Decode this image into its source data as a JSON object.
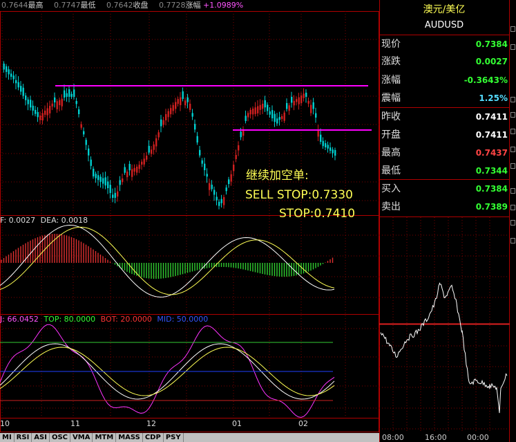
{
  "header": {
    "items": [
      {
        "value": "0.7644",
        "label": "最高"
      },
      {
        "value": "0.7747",
        "label": "最低"
      },
      {
        "value": "0.7642",
        "label": "收盘"
      },
      {
        "value": "0.7728",
        "label": "涨幅"
      }
    ],
    "change": "+1.0989%"
  },
  "macd_header": {
    "dif": "F: 0.0027",
    "dea": "DEA: 0.0018"
  },
  "kdj_header": {
    "j": "J: 66.0452",
    "top": "TOP: 80.0000",
    "bot": "BOT: 20.0000",
    "mid": "MID: 50.0000"
  },
  "annotation": {
    "line1": "继续加空单:",
    "line2": "SELL STOP:0.7330",
    "line3": "STOP:0.7410"
  },
  "x_axis": [
    "10",
    "11",
    "12",
    "01",
    "02"
  ],
  "tabs": [
    "MI",
    "RSI",
    "ASI",
    "OSC",
    "VMA",
    "MTM",
    "MASS",
    "CDP",
    "PSY"
  ],
  "sidebar": {
    "title": "澳元/美亿",
    "symbol": "AUDUSD",
    "rows": [
      {
        "label": "现价",
        "value": "0.7384",
        "color": "#33ff33"
      },
      {
        "label": "涨跌",
        "value": "0.0027",
        "color": "#33ff33"
      },
      {
        "label": "涨幅",
        "value": "-0.3643%",
        "color": "#33ff33"
      },
      {
        "label": "震幅",
        "value": "1.25%",
        "color": "#55ddff"
      },
      {
        "label": "昨收",
        "value": "0.7411",
        "color": "#ffffff"
      },
      {
        "label": "开盘",
        "value": "0.7411",
        "color": "#ffffff"
      },
      {
        "label": "最高",
        "value": "0.7437",
        "color": "#ff4444"
      },
      {
        "label": "最低",
        "value": "0.7344",
        "color": "#33ff33"
      },
      {
        "label": "买入",
        "value": "0.7384",
        "color": "#33ff33"
      },
      {
        "label": "卖出",
        "value": "0.7389",
        "color": "#33ff33"
      }
    ],
    "time_axis": [
      "08:00",
      "16:00",
      "00:00"
    ]
  },
  "colors": {
    "up": "#d02020",
    "down": "#00d0d0",
    "resistance": "#ff00ff",
    "grid": "#800000"
  }
}
